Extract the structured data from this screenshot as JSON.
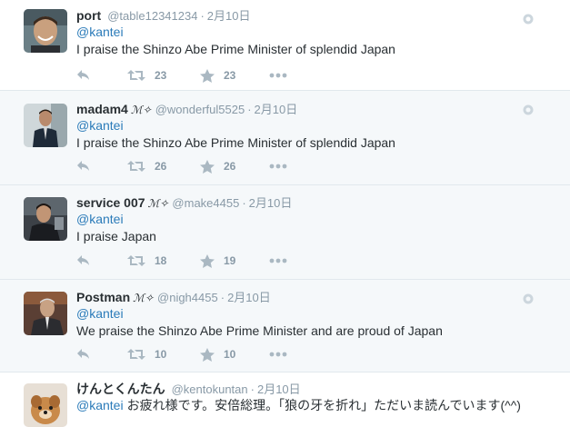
{
  "colors": {
    "link": "#2b7bb9",
    "muted": "#8899a6",
    "text": "#292f33",
    "divider": "#e1e8ed",
    "alt_background": "#f5f8fa"
  },
  "tweets": [
    {
      "name": "port",
      "badge": "",
      "handle": "@table12341234",
      "separator": "·",
      "date": "2月10日",
      "mention": "@kantei",
      "text": "I praise the Shinzo Abe Prime Minister of splendid Japan",
      "retweets": "23",
      "favorites": "23"
    },
    {
      "name": "madam4",
      "badge": "ℳ✧",
      "handle": "@wonderful5525",
      "separator": "·",
      "date": "2月10日",
      "mention": "@kantei",
      "text": "I praise the Shinzo Abe Prime Minister of splendid Japan",
      "retweets": "26",
      "favorites": "26"
    },
    {
      "name": "service 007",
      "badge": "ℳ✧",
      "handle": "@make4455",
      "separator": "·",
      "date": "2月10日",
      "mention": "@kantei",
      "text": "I praise Japan",
      "retweets": "18",
      "favorites": "19"
    },
    {
      "name": "Postman",
      "badge": "ℳ✧",
      "handle": "@nigh4455",
      "separator": "·",
      "date": "2月10日",
      "mention": "@kantei",
      "text": "We praise the Shinzo Abe Prime Minister and are proud of Japan",
      "retweets": "10",
      "favorites": "10"
    },
    {
      "name": "けんとくんたん",
      "badge": "",
      "handle": "@kentokuntan",
      "separator": "·",
      "date": "2月10日",
      "mention": "@kantei",
      "text": "お疲れ様です。安倍総理。「狼の牙を折れ」ただいま読んでいます(^^)"
    }
  ],
  "icons": {
    "reply": "reply-arrow-icon",
    "retweet": "retweet-icon",
    "favorite": "star-icon",
    "more": "more-dots-icon",
    "menu": "globe-icon"
  }
}
